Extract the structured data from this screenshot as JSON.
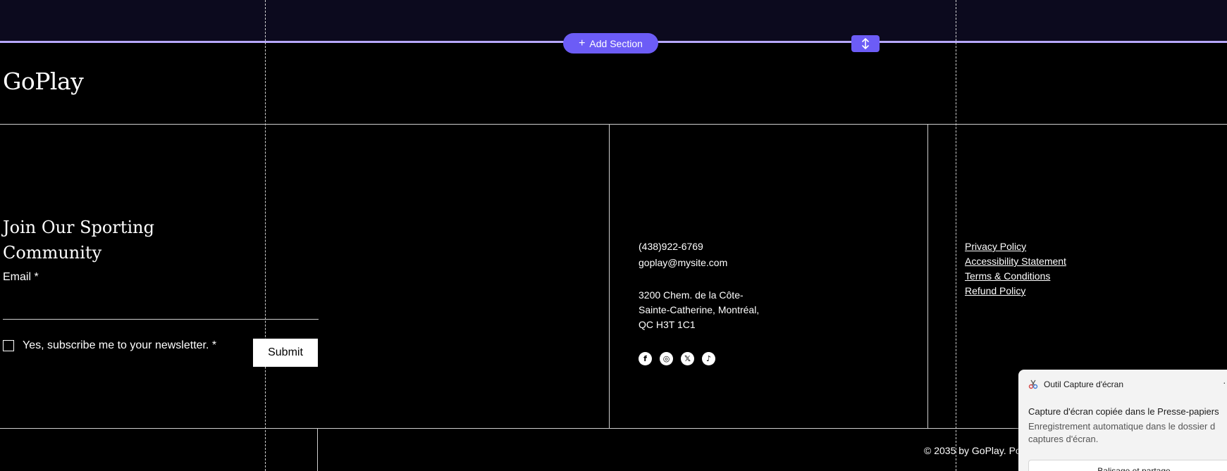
{
  "editor": {
    "add_section_label": "Add Section",
    "plus_glyph": "+"
  },
  "footer": {
    "logo": "GoPlay",
    "newsletter": {
      "title": "Join Our Sporting Community",
      "email_label": "Email *",
      "email_value": "",
      "checkbox_label": "Yes, subscribe me to your newsletter. *",
      "submit_label": "Submit"
    },
    "contact": {
      "phone": "(438)922-6769",
      "email": "goplay@mysite.com",
      "address_line1": "3200 Chem. de la Côte-",
      "address_line2": "Sainte-Catherine, Montréal,",
      "address_line3": "QC H3T 1C1"
    },
    "socials": [
      {
        "name": "facebook-icon",
        "glyph": "f"
      },
      {
        "name": "instagram-icon",
        "glyph": "◎"
      },
      {
        "name": "x-icon",
        "glyph": "𝕏"
      },
      {
        "name": "tiktok-icon",
        "glyph": "♪"
      }
    ],
    "policies": [
      "Privacy Policy",
      "Accessibility Statement",
      "Terms & Conditions",
      "Refund Policy"
    ],
    "copyright": "© 2035 by GoPlay. Po"
  },
  "toast": {
    "app_name": "Outil Capture d'écran",
    "more_glyph": "···",
    "title": "Capture d'écran copiée dans le Presse-papiers",
    "body": "Enregistrement automatique dans le dossier d captures d'écran.",
    "action_label": "Balisage et partage"
  },
  "colors": {
    "accent": "#6c5cf6",
    "section_line": "#b7a8ff",
    "background": "#000000"
  }
}
